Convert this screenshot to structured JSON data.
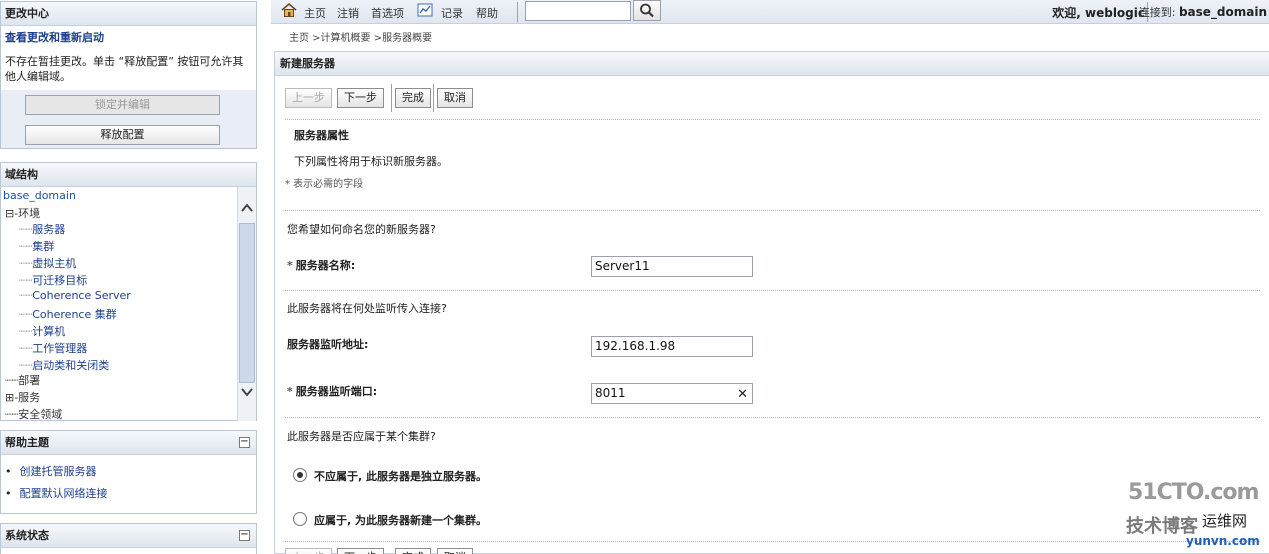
{
  "left": {
    "change_center": {
      "title": "更改中心",
      "subtitle": "查看更改和重新启动",
      "description": "不存在暂挂更改。单击 “释放配置” 按钮可允许其他人编辑域。",
      "lock_button": "锁定并编辑",
      "release_button": "释放配置"
    },
    "domain_structure": {
      "title": "域结构",
      "root": "base_domain",
      "env": "⊟-环境",
      "children": [
        "服务器",
        "集群",
        "虚拟主机",
        "可迁移目标",
        "Coherence Server",
        "Coherence 集群",
        "计算机",
        "工作管理器",
        "启动类和关闭类"
      ],
      "deploy": "部署",
      "services": "⊞-服务",
      "security": "安全领域"
    },
    "help_topics": {
      "title": "帮助主题",
      "items": [
        "创建托管服务器",
        "配置默认网络连接"
      ]
    },
    "system_status": {
      "title": "系统状态"
    }
  },
  "topbar": {
    "home": "主页",
    "logout": "注销",
    "preferences": "首选项",
    "record": "记录",
    "help": "帮助",
    "welcome": "欢迎, weblogic",
    "connected_label": "连接到:",
    "connected_domain": "base_domain"
  },
  "breadcrumb": "主页 >计算机概要 >服务器概要",
  "main": {
    "title": "新建服务器",
    "buttons": {
      "back": "上一步",
      "next": "下一步",
      "finish": "完成",
      "cancel": "取消"
    },
    "section_title": "服务器属性",
    "section_desc": "下列属性将用于标识新服务器。",
    "required_note": "* 表示必需的字段",
    "q_name": "您希望如何命名您的新服务器?",
    "server_name_label": "服务器名称:",
    "server_name_value": "Server11",
    "q_listen": "此服务器将在何处监听传入连接?",
    "listen_addr_label": "服务器监听地址:",
    "listen_addr_value": "192.168.1.98",
    "listen_port_label": "服务器监听端口:",
    "listen_port_value": "8011",
    "q_cluster": "此服务器是否应属于某个集群?",
    "radio_standalone": "不应属于, 此服务器是独立服务器。",
    "radio_new_cluster": "应属于, 为此服务器新建一个集群。"
  },
  "watermark": {
    "line1": "51CTO.com",
    "line2": "技术博客",
    "line3": "运维网",
    "line4": "yunvn.com"
  }
}
